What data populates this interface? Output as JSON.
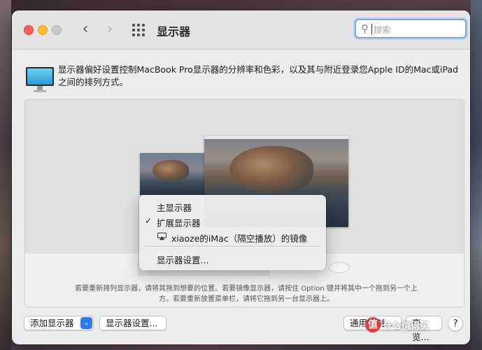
{
  "window": {
    "title": "显示器",
    "search_placeholder": "搜索"
  },
  "description": "显示器偏好设置控制MacBook Pro显示器的分辨率和色彩，以及其与附近登录您Apple ID的Mac或iPad之间的排列方式。",
  "context_menu": {
    "items": [
      {
        "label": "主显示器",
        "checked": false
      },
      {
        "label": "扩展显示器",
        "checked": true
      },
      {
        "label": "xiaoze的iMac（隔空播放）的镜像",
        "icon": "airplay-icon"
      },
      {
        "label": "显示器设置..."
      }
    ]
  },
  "hint": {
    "line1": "若要重新排列显示器，请将其拖到想要的位置。若要镜像显示器，请按住 Option 键并将其中一个拖到另一个上",
    "line2": "方。若要重新放置菜单栏，请将它拖到另一台显示器上。"
  },
  "buttons": {
    "add_display": "添加显示器",
    "display_settings": "显示器设置...",
    "universal_control": "通用控制...",
    "night_shift": "夜览...",
    "help": "?"
  },
  "watermark": {
    "badge": "值",
    "text": "什么值得买"
  },
  "colors": {
    "accent": "#2d7cf6",
    "close": "#fe5f57",
    "minimize": "#febc2e",
    "zoom_disabled": "#c8c8c8",
    "search_focus": "#7aa7e6"
  }
}
